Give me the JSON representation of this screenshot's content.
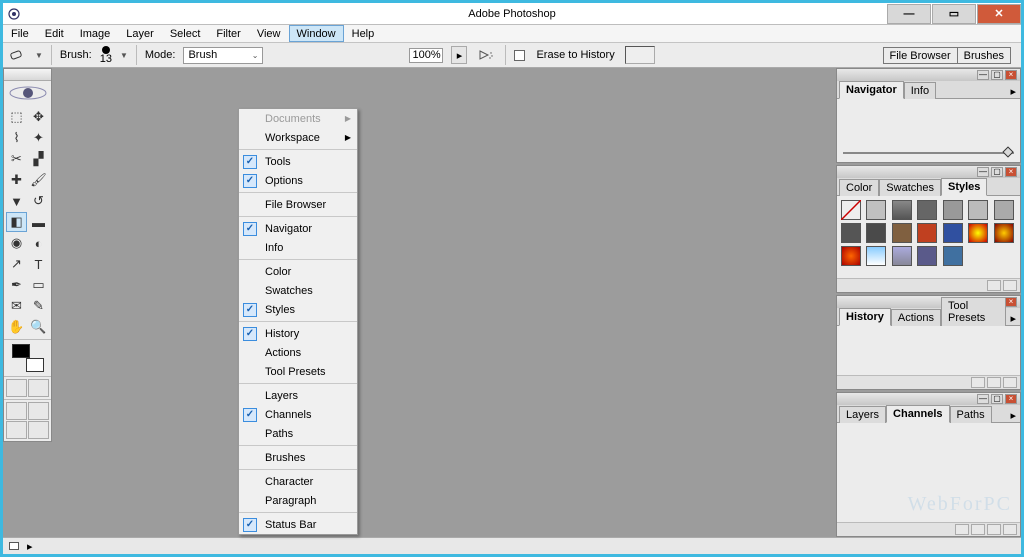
{
  "window": {
    "title": "Adobe Photoshop"
  },
  "menubar": [
    "File",
    "Edit",
    "Image",
    "Layer",
    "Select",
    "Filter",
    "View",
    "Window",
    "Help"
  ],
  "options": {
    "brush_label": "Brush:",
    "brush_size": "13",
    "mode_label": "Mode:",
    "mode_value": "Brush",
    "opacity_value": "100%",
    "erase_history": "Erase to History",
    "fb_tabs": [
      "File Browser",
      "Brushes"
    ]
  },
  "dropdown": {
    "groups": [
      [
        {
          "label": "Documents",
          "arrow": true,
          "disabled": true
        },
        {
          "label": "Workspace",
          "arrow": true
        }
      ],
      [
        {
          "label": "Tools",
          "checked": true
        },
        {
          "label": "Options",
          "checked": true
        }
      ],
      [
        {
          "label": "File Browser"
        }
      ],
      [
        {
          "label": "Navigator",
          "checked": true
        },
        {
          "label": "Info"
        }
      ],
      [
        {
          "label": "Color"
        },
        {
          "label": "Swatches"
        },
        {
          "label": "Styles",
          "checked": true
        }
      ],
      [
        {
          "label": "History",
          "checked": true
        },
        {
          "label": "Actions"
        },
        {
          "label": "Tool Presets"
        }
      ],
      [
        {
          "label": "Layers"
        },
        {
          "label": "Channels",
          "checked": true
        },
        {
          "label": "Paths"
        }
      ],
      [
        {
          "label": "Brushes"
        }
      ],
      [
        {
          "label": "Character"
        },
        {
          "label": "Paragraph"
        }
      ],
      [
        {
          "label": "Status Bar",
          "checked": true
        }
      ]
    ]
  },
  "panels": {
    "nav": {
      "tabs": [
        "Navigator",
        "Info"
      ],
      "active": 0
    },
    "styles": {
      "tabs": [
        "Color",
        "Swatches",
        "Styles"
      ],
      "active": 2
    },
    "history": {
      "tabs": [
        "History",
        "Actions",
        "Tool Presets"
      ],
      "active": 0
    },
    "channels": {
      "tabs": [
        "Layers",
        "Channels",
        "Paths"
      ],
      "active": 1
    }
  },
  "watermark": "WebForPC"
}
